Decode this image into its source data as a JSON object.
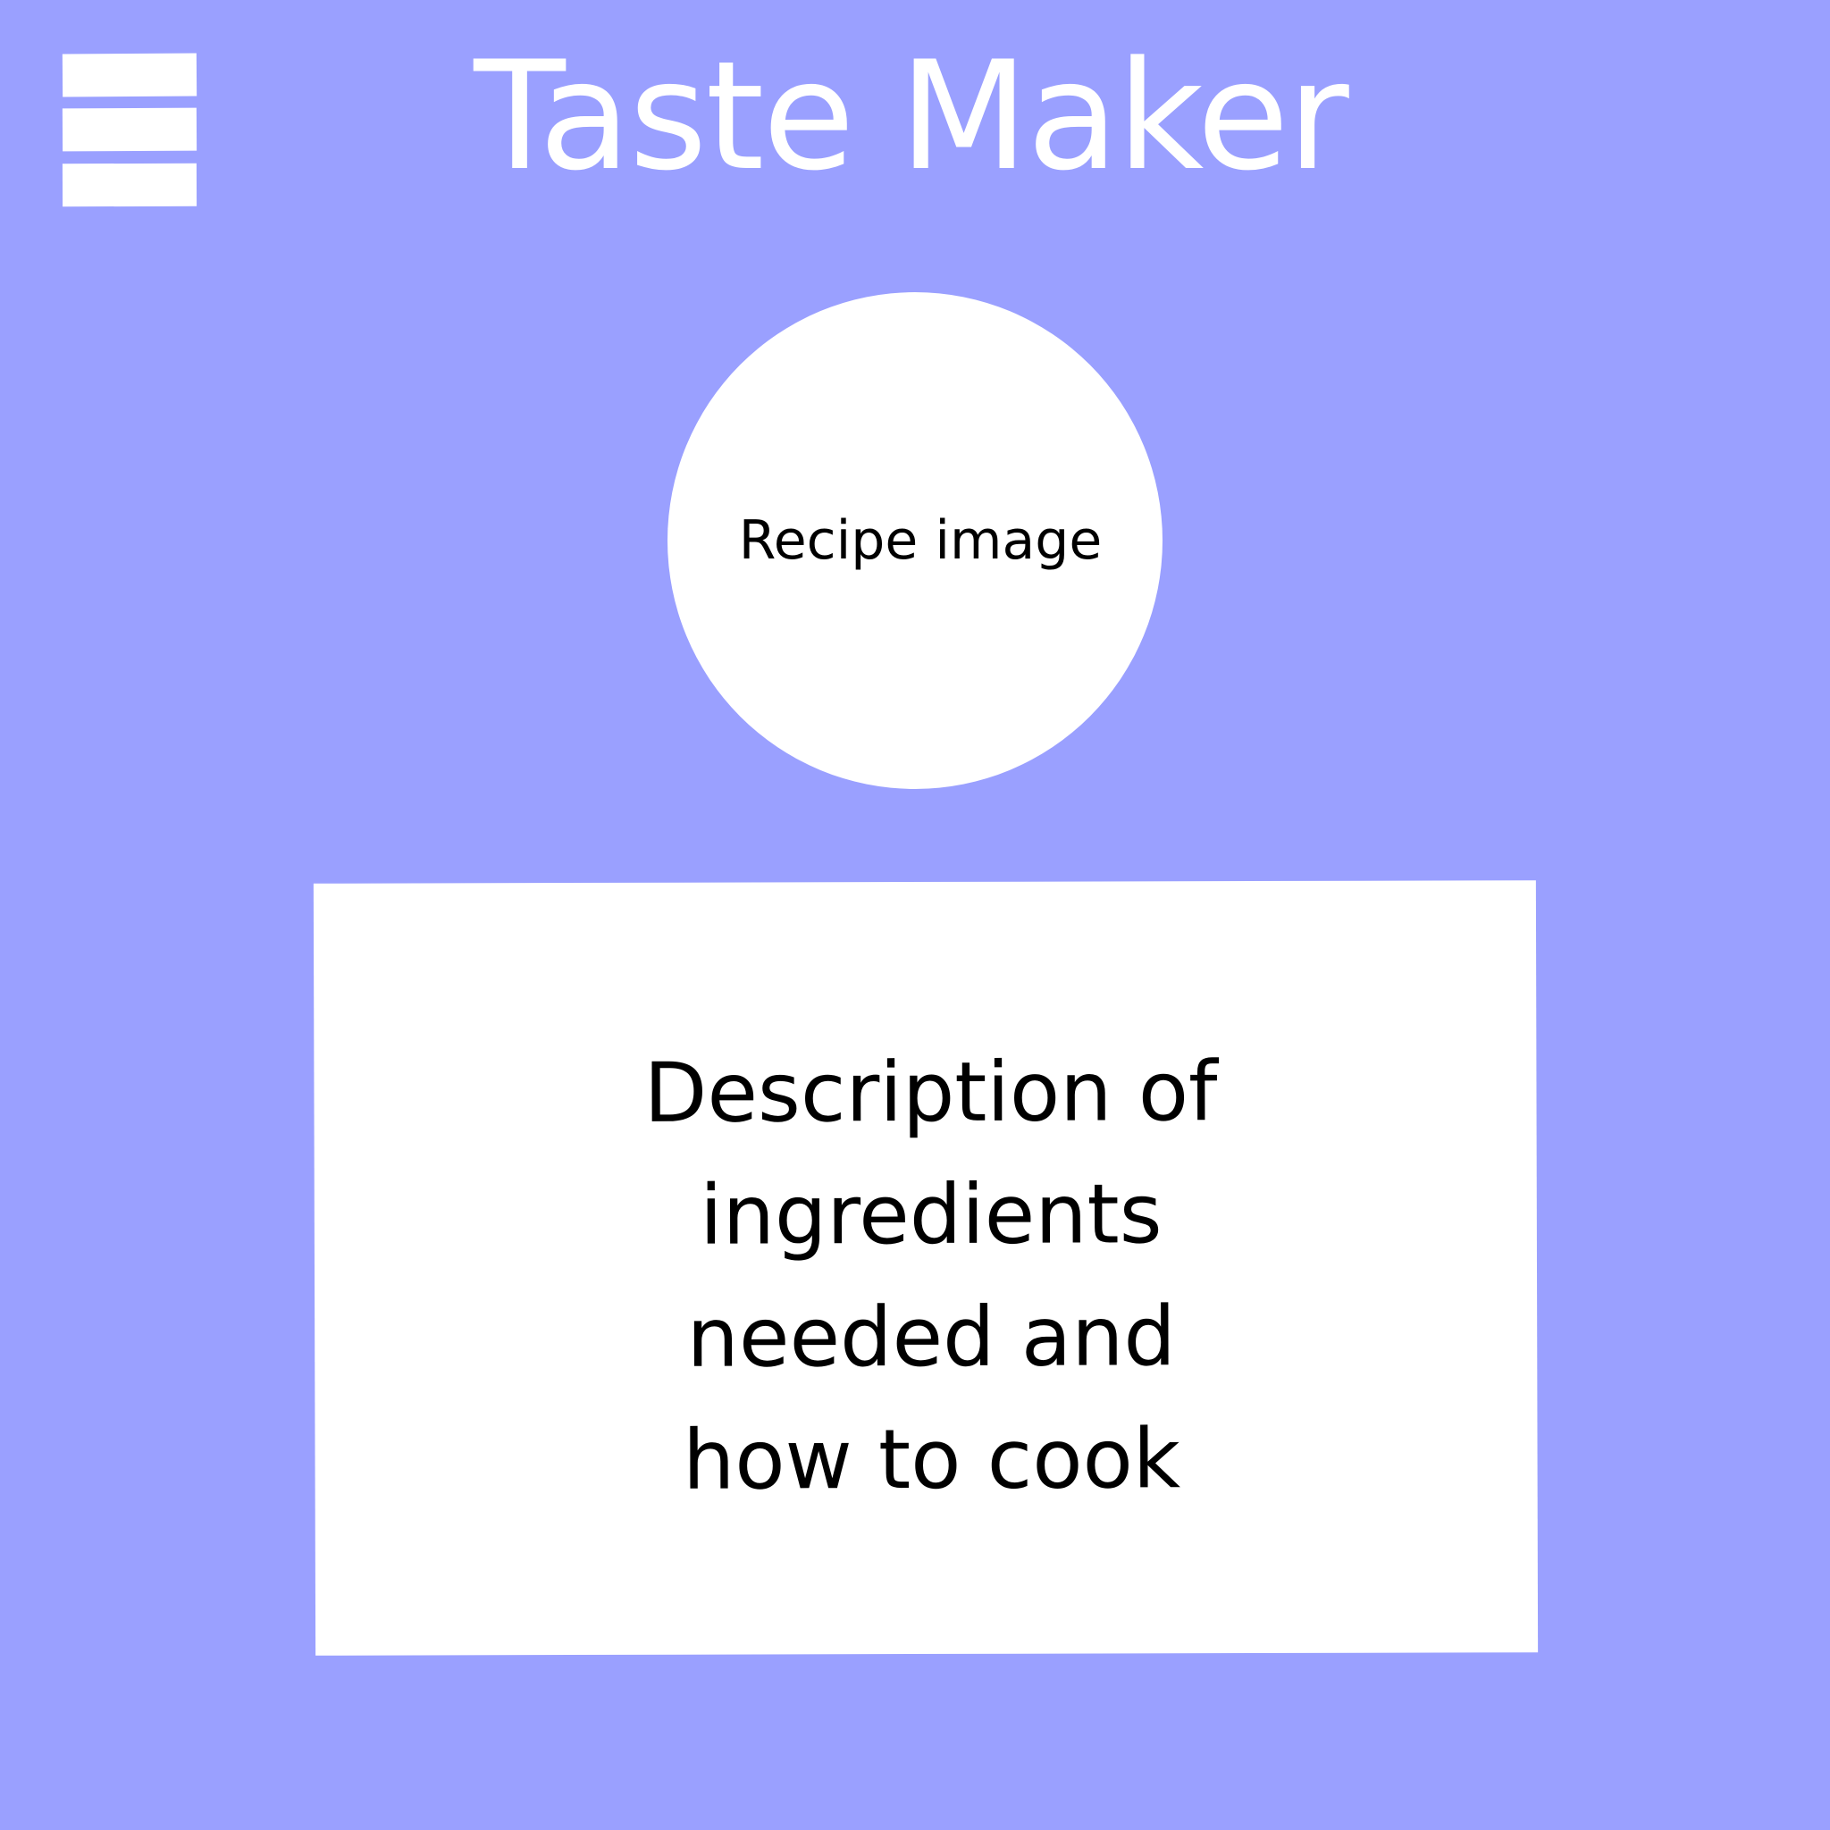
{
  "header": {
    "title": "Taste Maker",
    "menu_icon": "hamburger-menu-icon"
  },
  "recipe": {
    "image_label": "Recipe image",
    "description": "Description of ingredients needed and how to cook"
  },
  "colors": {
    "background": "#9aa0ff",
    "card": "#ffffff",
    "title_text": "#ffffff",
    "body_text": "#000000"
  }
}
